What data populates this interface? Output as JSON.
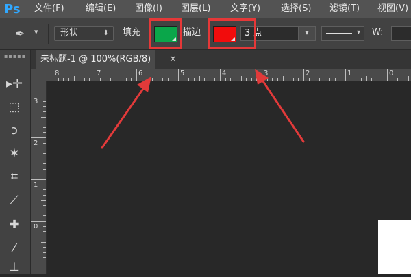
{
  "app": {
    "logo": "Ps",
    "menu": [
      "文件(F)",
      "编辑(E)",
      "图像(I)",
      "图层(L)",
      "文字(Y)",
      "选择(S)",
      "滤镜(T)",
      "视图(V)"
    ]
  },
  "options": {
    "mode": "形状",
    "fill_label": "填充",
    "stroke_label": "描边",
    "fill_color": "#0aa64a",
    "stroke_color": "#f20c0c",
    "stroke_width": "3 点",
    "width_label": "W:"
  },
  "document": {
    "tab_title": "未标题-1 @ 100%(RGB/8)",
    "close_glyph": "×"
  },
  "ruler": {
    "top_labels": [
      "8",
      "7",
      "6",
      "5",
      "4",
      "3",
      "2",
      "1",
      "0"
    ],
    "left_labels": [
      "3",
      "2",
      "1",
      "0"
    ]
  },
  "tools": [
    {
      "icon": "move-icon",
      "glyph": "▸✛"
    },
    {
      "icon": "marquee-icon",
      "glyph": "⬚"
    },
    {
      "icon": "lasso-icon",
      "glyph": "ↄ"
    },
    {
      "icon": "magic-wand-icon",
      "glyph": "✶"
    },
    {
      "icon": "crop-icon",
      "glyph": "⌗"
    },
    {
      "icon": "eyedropper-icon",
      "glyph": "⟋"
    },
    {
      "icon": "healing-brush-icon",
      "glyph": "✚"
    },
    {
      "icon": "brush-icon",
      "glyph": "⁄"
    },
    {
      "icon": "stamp-icon",
      "glyph": "⊥"
    }
  ],
  "colors": {
    "highlight": "#e53838",
    "arrow": "#e23a3a"
  }
}
